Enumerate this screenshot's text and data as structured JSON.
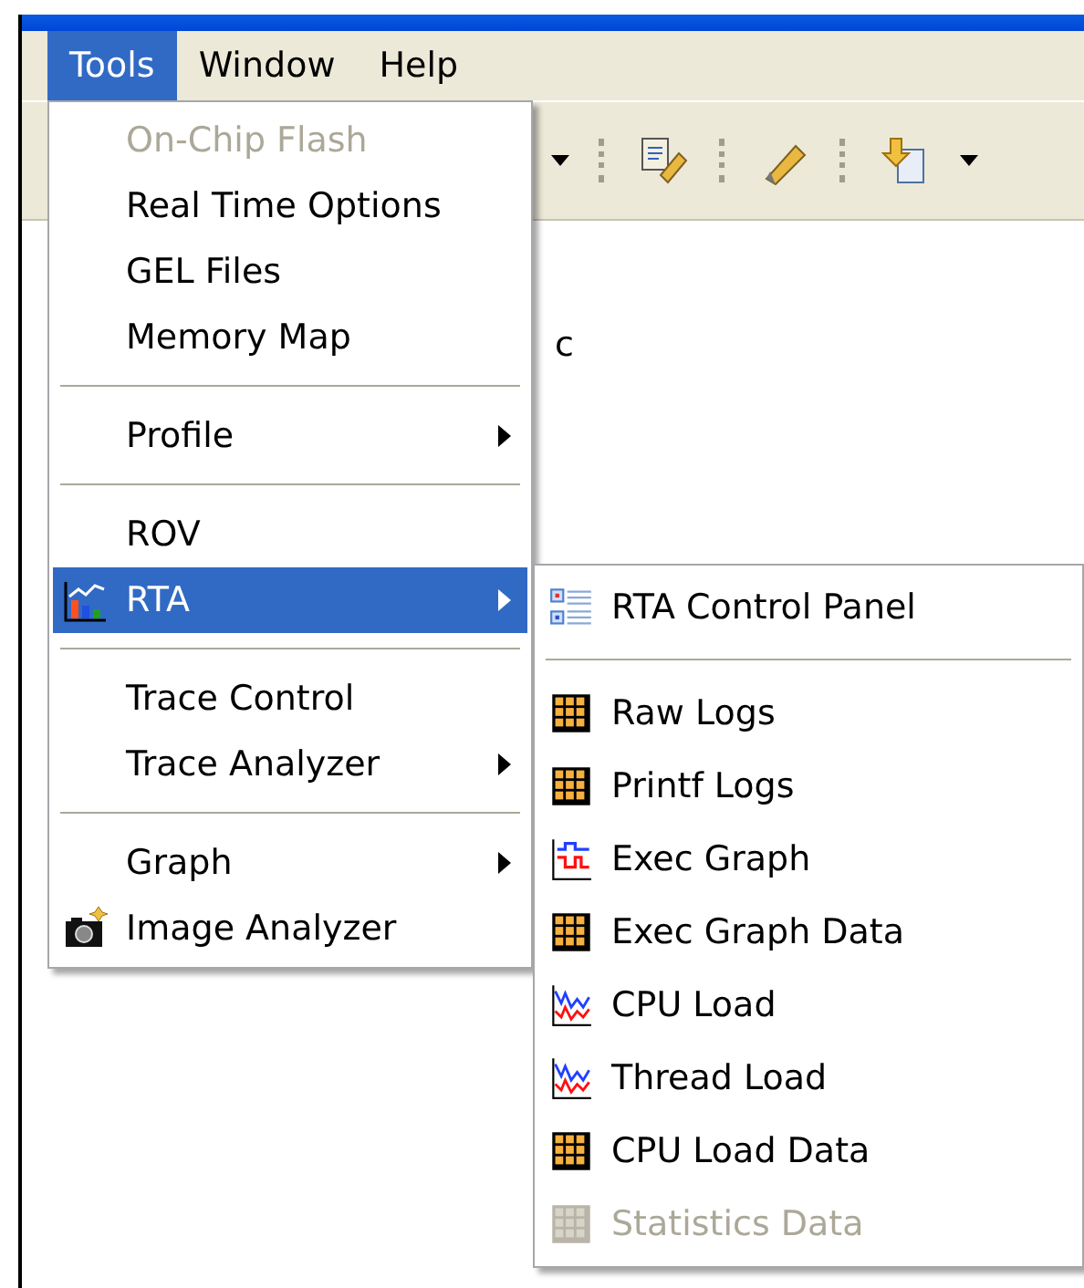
{
  "menubar": [
    {
      "label": "Tools",
      "selected": true
    },
    {
      "label": "Window",
      "selected": false
    },
    {
      "label": "Help",
      "selected": false
    }
  ],
  "editor_text": "c",
  "tools_menu": [
    {
      "kind": "plain",
      "label": "On-Chip Flash",
      "disabled": true,
      "selected": false,
      "submenu": false
    },
    {
      "kind": "plain",
      "label": "Real Time Options",
      "disabled": false,
      "selected": false,
      "submenu": false
    },
    {
      "kind": "plain",
      "label": "GEL Files",
      "disabled": false,
      "selected": false,
      "submenu": false
    },
    {
      "kind": "plain",
      "label": "Memory Map",
      "disabled": false,
      "selected": false,
      "submenu": false
    },
    {
      "kind": "separator"
    },
    {
      "kind": "plain",
      "label": "Profile",
      "disabled": false,
      "selected": false,
      "submenu": true
    },
    {
      "kind": "separator"
    },
    {
      "kind": "plain",
      "label": "ROV",
      "disabled": false,
      "selected": false,
      "submenu": false
    },
    {
      "kind": "chart",
      "label": "RTA",
      "disabled": false,
      "selected": true,
      "submenu": true
    },
    {
      "kind": "separator"
    },
    {
      "kind": "plain",
      "label": "Trace Control",
      "disabled": false,
      "selected": false,
      "submenu": false
    },
    {
      "kind": "plain",
      "label": "Trace Analyzer",
      "disabled": false,
      "selected": false,
      "submenu": true
    },
    {
      "kind": "separator"
    },
    {
      "kind": "plain",
      "label": "Graph",
      "disabled": false,
      "selected": false,
      "submenu": true
    },
    {
      "kind": "camera",
      "label": "Image Analyzer",
      "disabled": false,
      "selected": false,
      "submenu": false
    }
  ],
  "rta_submenu": [
    {
      "kind": "panel",
      "label": "RTA Control Panel",
      "disabled": false
    },
    {
      "kind": "separator"
    },
    {
      "kind": "table",
      "label": "Raw Logs",
      "disabled": false
    },
    {
      "kind": "table",
      "label": "Printf Logs",
      "disabled": false
    },
    {
      "kind": "steps",
      "label": "Exec Graph",
      "disabled": false
    },
    {
      "kind": "table",
      "label": "Exec Graph Data",
      "disabled": false
    },
    {
      "kind": "load",
      "label": "CPU Load",
      "disabled": false
    },
    {
      "kind": "load",
      "label": "Thread Load",
      "disabled": false
    },
    {
      "kind": "table",
      "label": "CPU Load Data",
      "disabled": false
    },
    {
      "kind": "table",
      "label": "Statistics Data",
      "disabled": true
    }
  ]
}
